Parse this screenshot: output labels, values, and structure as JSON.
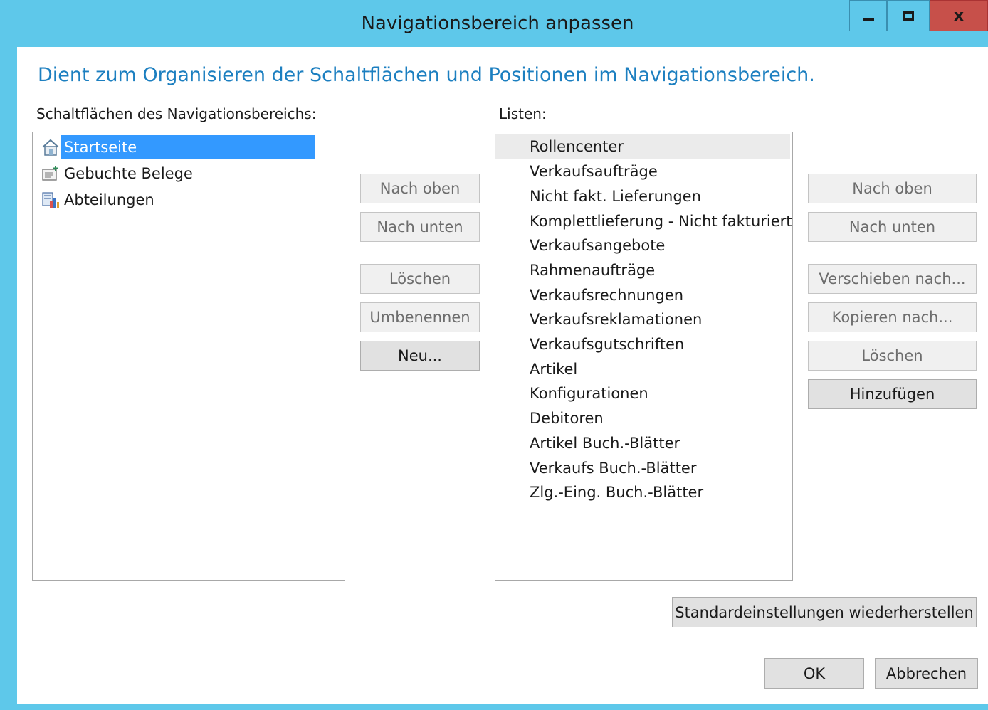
{
  "window": {
    "title": "Navigationsbereich anpassen"
  },
  "heading": "Dient zum Organisieren der Schaltflächen und Positionen im Navigationsbereich.",
  "left": {
    "label": "Schaltflächen des Navigationsbereichs:",
    "items": [
      {
        "label": "Startseite",
        "icon": "home-icon",
        "selected": true
      },
      {
        "label": "Gebuchte Belege",
        "icon": "posted-documents-icon",
        "selected": false
      },
      {
        "label": "Abteilungen",
        "icon": "departments-icon",
        "selected": false
      }
    ],
    "buttons": {
      "move_up": "Nach oben",
      "move_down": "Nach unten",
      "delete": "Löschen",
      "rename": "Umbenennen",
      "new": "Neu..."
    }
  },
  "right": {
    "label": "Listen:",
    "items": [
      "Rollencenter",
      "Verkaufsaufträge",
      "Nicht fakt. Lieferungen",
      "Komplettlieferung - Nicht fakturiert",
      "Verkaufsangebote",
      "Rahmenaufträge",
      "Verkaufsrechnungen",
      "Verkaufsreklamationen",
      "Verkaufsgutschriften",
      "Artikel",
      "Konfigurationen",
      "Debitoren",
      "Artikel Buch.-Blätter",
      "Verkaufs Buch.-Blätter",
      "Zlg.-Eing. Buch.-Blätter"
    ],
    "buttons": {
      "move_up": "Nach oben",
      "move_down": "Nach unten",
      "move_to": "Verschieben nach...",
      "copy_to": "Kopieren nach...",
      "delete": "Löschen",
      "add": "Hinzufügen"
    }
  },
  "footer": {
    "restore_defaults": "Standardeinstellungen wiederherstellen",
    "ok": "OK",
    "cancel": "Abbrechen"
  },
  "colors": {
    "chrome": "#5ec8ea",
    "close": "#c7504a",
    "heading": "#1c7fc0",
    "selection": "#3399ff"
  }
}
